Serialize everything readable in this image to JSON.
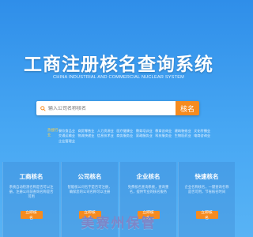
{
  "header": {
    "title": "工商注册核名查询系统",
    "subtitle": "CHINA INDUSTRIAL AND COMMERCIAL NUCLEAR SYSTEM"
  },
  "search": {
    "placeholder": "输入公司名称核名",
    "button_label": "核名"
  },
  "hot": {
    "label": "热搜行业",
    "links": [
      "餐饮食品业",
      "商贸零售业",
      "人力资源业",
      "医疗健康业",
      "教育培训业",
      "教育咨询业",
      "建筑装修业",
      "文化传播业",
      "交通运输业",
      "物流快递业",
      "信息技术业",
      "商务服务业",
      "家政服务业",
      "科技服务业",
      "生物医药业",
      "电商咨询业",
      "企业管理业"
    ]
  },
  "cards": [
    {
      "title": "工商核名",
      "desc": "系统自动检测名称是否可以注册，注册公司前查询名称是否可用",
      "button": "立即核名"
    },
    {
      "title": "公司核名",
      "desc": "智能核公司名字是否可注册，确保您的公司名称可以注册",
      "button": "立即核名"
    },
    {
      "title": "企业核名",
      "desc": "免费核名查询系统，查询重名，提供专业的核名服务",
      "button": "立即核名"
    },
    {
      "title": "快速核名",
      "desc": "企业名称核名，一键查询名称是否可用，节省核名时间",
      "button": "立即核名"
    }
  ],
  "watermark": "美寮州保管",
  "colors": {
    "accent": "#f68b1f",
    "background_top": "#2f8ee9",
    "background_bottom": "#58b3f5"
  }
}
